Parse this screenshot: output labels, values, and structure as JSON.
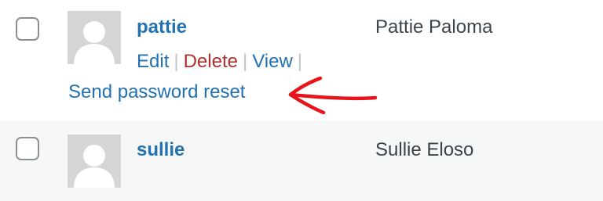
{
  "users": [
    {
      "username": "pattie",
      "name": "Pattie Paloma",
      "actions": {
        "edit": "Edit",
        "delete": "Delete",
        "view": "View",
        "separator": "|",
        "send_password_reset": "Send password reset"
      }
    },
    {
      "username": "sullie",
      "name": "Sullie Eloso"
    }
  ],
  "colors": {
    "link": "#2271b1",
    "delete": "#b32d2e",
    "text": "#3c434a",
    "alt_row_bg": "#f6f7f7",
    "annotation_arrow": "#e8141c"
  },
  "icons": {
    "avatar": "default-avatar-silhouette",
    "annotation": "hand-drawn-arrow-left"
  }
}
